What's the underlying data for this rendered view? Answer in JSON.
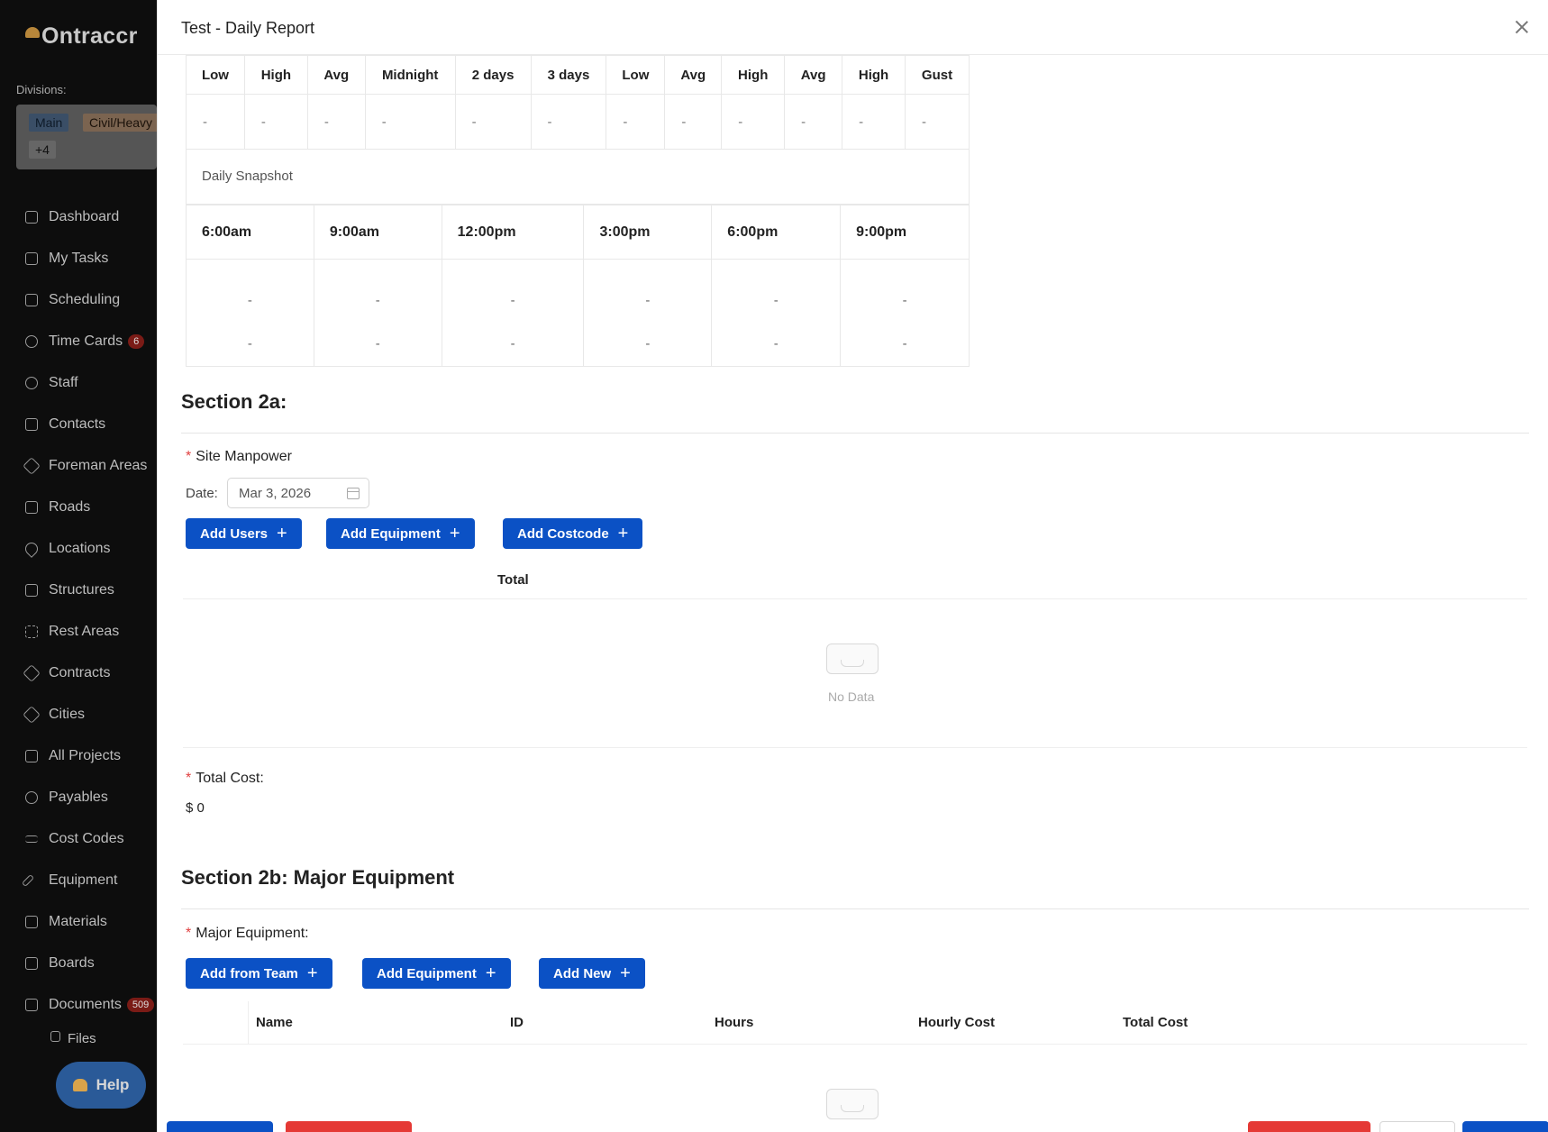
{
  "sidebar": {
    "logo": "Ontraccr",
    "divisions_label": "Divisions:",
    "division_tags": [
      "Main",
      "Civil/Heavy",
      "+4"
    ],
    "items": [
      {
        "label": "Dashboard",
        "icon": "home-icon"
      },
      {
        "label": "My Tasks",
        "icon": "tasks-icon"
      },
      {
        "label": "Scheduling",
        "icon": "calendar-icon"
      },
      {
        "label": "Time Cards",
        "icon": "clock-icon",
        "badge": "6"
      },
      {
        "label": "Staff",
        "icon": "user-icon"
      },
      {
        "label": "Contacts",
        "icon": "contacts-icon"
      },
      {
        "label": "Foreman Areas",
        "icon": "diamond-icon"
      },
      {
        "label": "Roads",
        "icon": "list-icon"
      },
      {
        "label": "Locations",
        "icon": "pin-icon"
      },
      {
        "label": "Structures",
        "icon": "bank-icon"
      },
      {
        "label": "Rest Areas",
        "icon": "area-icon"
      },
      {
        "label": "Contracts",
        "icon": "diamond-icon"
      },
      {
        "label": "Cities",
        "icon": "diamond-icon"
      },
      {
        "label": "All Projects",
        "icon": "project-icon"
      },
      {
        "label": "Payables",
        "icon": "dollar-icon"
      },
      {
        "label": "Cost Codes",
        "icon": "swap-icon"
      },
      {
        "label": "Equipment",
        "icon": "tool-icon"
      },
      {
        "label": "Materials",
        "icon": "materials-icon"
      },
      {
        "label": "Boards",
        "icon": "board-icon"
      },
      {
        "label": "Documents",
        "icon": "document-icon",
        "badge": "509"
      }
    ],
    "sub_item": "Files",
    "help_label": "Help"
  },
  "drawer": {
    "title": "Test - Daily Report"
  },
  "weather": {
    "headers": [
      "Low",
      "High",
      "Avg",
      "Midnight",
      "2 days",
      "3 days",
      "Low",
      "Avg",
      "High",
      "Avg",
      "High",
      "Gust"
    ],
    "values": [
      "-",
      "-",
      "-",
      "-",
      "-",
      "-",
      "-",
      "-",
      "-",
      "-",
      "-",
      "-"
    ],
    "snapshot_label": "Daily Snapshot",
    "snapshot_times": [
      "6:00am",
      "9:00am",
      "12:00pm",
      "3:00pm",
      "6:00pm",
      "9:00pm"
    ],
    "snapshot_row1": [
      "-",
      "-",
      "-",
      "-",
      "-",
      "-"
    ],
    "snapshot_row2": [
      "-",
      "-",
      "-",
      "-",
      "-",
      "-"
    ]
  },
  "section2a": {
    "title": "Section 2a:",
    "field_label": "Site Manpower",
    "date_label": "Date:",
    "date_value": "Mar 3, 2026",
    "buttons": [
      "Add Users",
      "Add Equipment",
      "Add Costcode"
    ],
    "table_header": "Total",
    "empty_text": "No Data",
    "total_cost_label": "Total Cost:",
    "total_cost_value": "$ 0"
  },
  "section2b": {
    "title": "Section 2b: Major Equipment",
    "field_label": "Major Equipment:",
    "buttons": [
      "Add from Team",
      "Add Equipment",
      "Add New"
    ],
    "columns": [
      "Name",
      "ID",
      "Hours",
      "Hourly Cost",
      "Total Cost"
    ]
  },
  "colors": {
    "primary_button": "#0b51c5",
    "danger_button": "#e53935",
    "required_star": "#e04040"
  }
}
